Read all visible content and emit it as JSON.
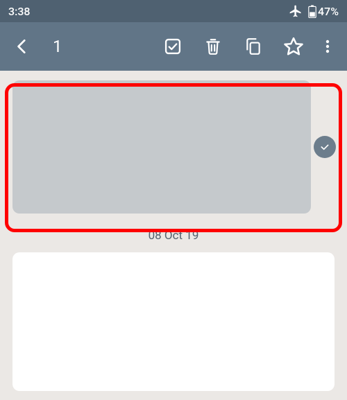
{
  "status": {
    "time": "3:38",
    "battery": "47%"
  },
  "appbar": {
    "selected_count": "1"
  },
  "notes": {
    "date_separator": "08 Oct 19"
  }
}
